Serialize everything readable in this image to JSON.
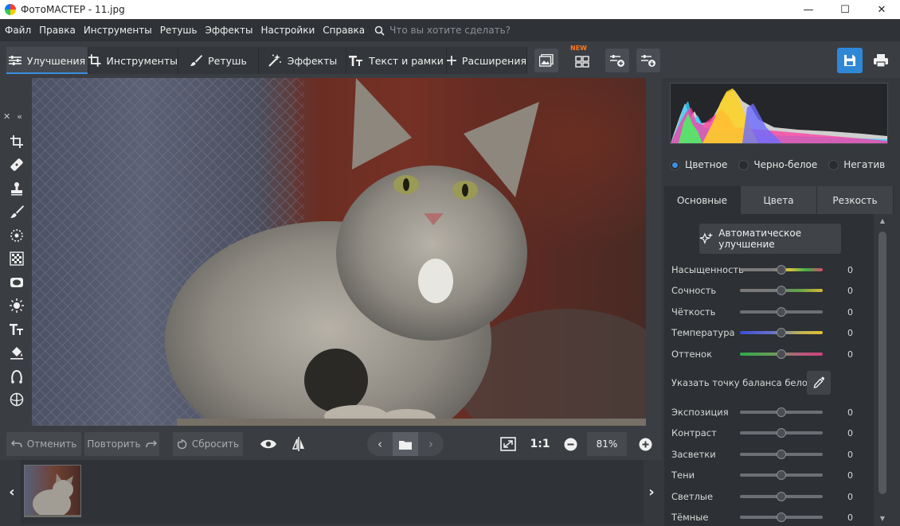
{
  "window": {
    "title": "ФотоМАСТЕР - 11.jpg",
    "minimize": "—",
    "maximize": "☐",
    "close": "✕"
  },
  "menu": {
    "items": [
      "Файл",
      "Правка",
      "Инструменты",
      "Ретушь",
      "Эффекты",
      "Настройки",
      "Справка"
    ],
    "search_placeholder": "Что вы хотите сделать?"
  },
  "toolbar": {
    "tabs": [
      {
        "label": "Улучшения",
        "icon": "sliders-icon",
        "active": true
      },
      {
        "label": "Инструменты",
        "icon": "crop-icon",
        "active": false
      },
      {
        "label": "Ретушь",
        "icon": "brush-icon",
        "active": false
      },
      {
        "label": "Эффекты",
        "icon": "magic-wand-icon",
        "active": false
      },
      {
        "label": "Текст и рамки",
        "icon": "text-icon",
        "active": false
      },
      {
        "label": "Расширения",
        "icon": "plus-icon",
        "active": false
      }
    ],
    "new_badge": "NEW"
  },
  "bottom": {
    "undo": "Отменить",
    "redo": "Повторить",
    "reset": "Сбросить",
    "ratio": "1:1",
    "zoom": "81%"
  },
  "right_panel": {
    "modes": [
      {
        "label": "Цветное",
        "selected": true
      },
      {
        "label": "Черно-белое",
        "selected": false
      },
      {
        "label": "Негатив",
        "selected": false
      }
    ],
    "tabs": [
      {
        "label": "Основные",
        "active": true
      },
      {
        "label": "Цвета",
        "active": false
      },
      {
        "label": "Резкость",
        "active": false
      }
    ],
    "auto_button": "Автоматическое улучшение",
    "white_balance_label": "Указать точку баланса белого",
    "sliders_top": [
      {
        "label": "Насыщенность",
        "value": "0"
      },
      {
        "label": "Сочность",
        "value": "0"
      },
      {
        "label": "Чёткость",
        "value": "0"
      },
      {
        "label": "Температура",
        "value": "0"
      },
      {
        "label": "Оттенок",
        "value": "0"
      }
    ],
    "sliders_bottom": [
      {
        "label": "Экспозиция",
        "value": "0"
      },
      {
        "label": "Контраст",
        "value": "0"
      },
      {
        "label": "Засветки",
        "value": "0"
      },
      {
        "label": "Тени",
        "value": "0"
      },
      {
        "label": "Светлые",
        "value": "0"
      },
      {
        "label": "Тёмные",
        "value": "0"
      }
    ]
  },
  "colors": {
    "accent": "#3b8fe0",
    "panel": "#35383c",
    "background": "#3a3d42"
  }
}
